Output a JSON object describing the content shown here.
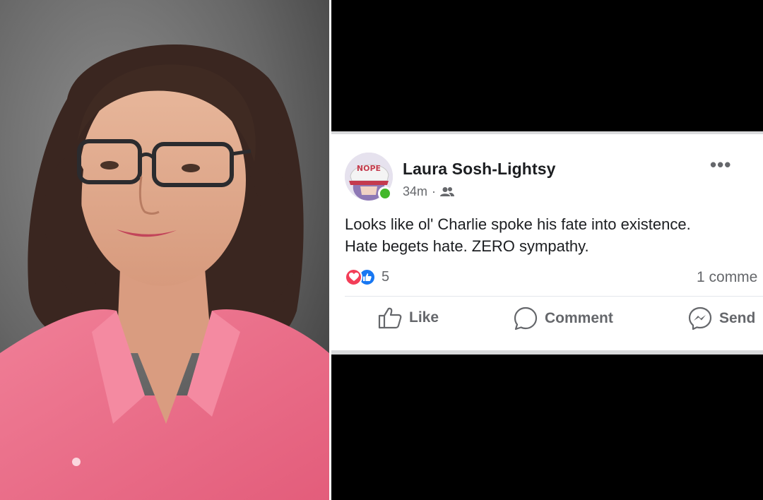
{
  "post": {
    "author": "Laura Sosh-Lightsy",
    "time": "34m",
    "separator": "·",
    "audience_icon": "friends-icon",
    "text_lines": [
      "Looks like ol' Charlie spoke his fate into existence.",
      "Hate begets hate. ZERO sympathy."
    ],
    "reaction_count": "5",
    "reaction_icons": [
      "love-reaction-icon",
      "like-reaction-icon"
    ],
    "comments_label": "1 comme",
    "avatar_hat_text": "NOPE",
    "more_label": "•••",
    "actions": {
      "like": "Like",
      "comment": "Comment",
      "send": "Send"
    }
  },
  "colors": {
    "facebook_blue": "#1877f2",
    "love_red": "#f33e58",
    "online_green": "#42b72a",
    "text_primary": "#1c1e21",
    "text_secondary": "#65676b",
    "shirt_pink": "#ec6b86"
  }
}
